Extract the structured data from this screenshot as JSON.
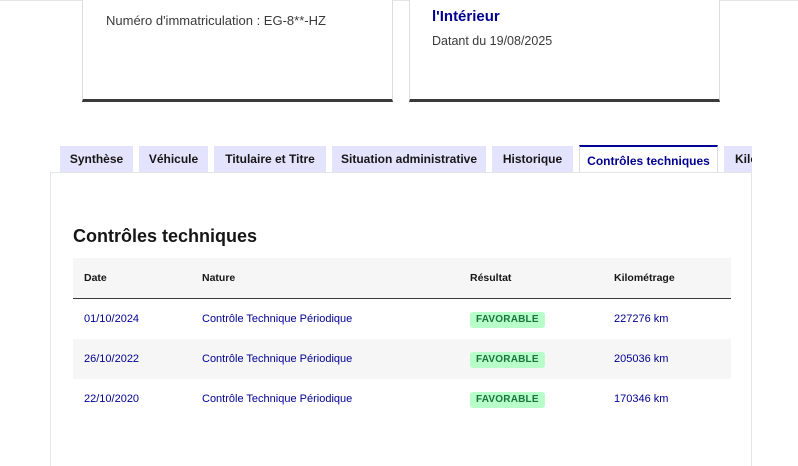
{
  "cards": {
    "left": {
      "registration": "Numéro d'immatriculation : EG-8**-HZ"
    },
    "right": {
      "title": "l'Intérieur",
      "date": "Datant du 19/08/2025"
    }
  },
  "tabs": [
    {
      "label": "Synthèse",
      "active": false
    },
    {
      "label": "Véhicule",
      "active": false
    },
    {
      "label": "Titulaire et Titre",
      "active": false
    },
    {
      "label": "Situation administrative",
      "active": false
    },
    {
      "label": "Historique",
      "active": false
    },
    {
      "label": "Contrôles techniques",
      "active": true
    },
    {
      "label": "Kilométrage",
      "active": false
    }
  ],
  "panel": {
    "title": "Contrôles techniques",
    "columns": [
      "Date",
      "Nature",
      "Résultat",
      "Kilométrage"
    ],
    "rows": [
      {
        "date": "01/10/2024",
        "nature": "Contrôle Technique Périodique",
        "result": "FAVORABLE",
        "km": "227276 km"
      },
      {
        "date": "26/10/2022",
        "nature": "Contrôle Technique Périodique",
        "result": "FAVORABLE",
        "km": "205036 km"
      },
      {
        "date": "22/10/2020",
        "nature": "Contrôle Technique Périodique",
        "result": "FAVORABLE",
        "km": "170346 km"
      }
    ]
  },
  "colors": {
    "accent": "#000091",
    "tab_bg": "#e3e3fd",
    "success_bg": "#b8fec9",
    "success_text": "#18753c"
  }
}
